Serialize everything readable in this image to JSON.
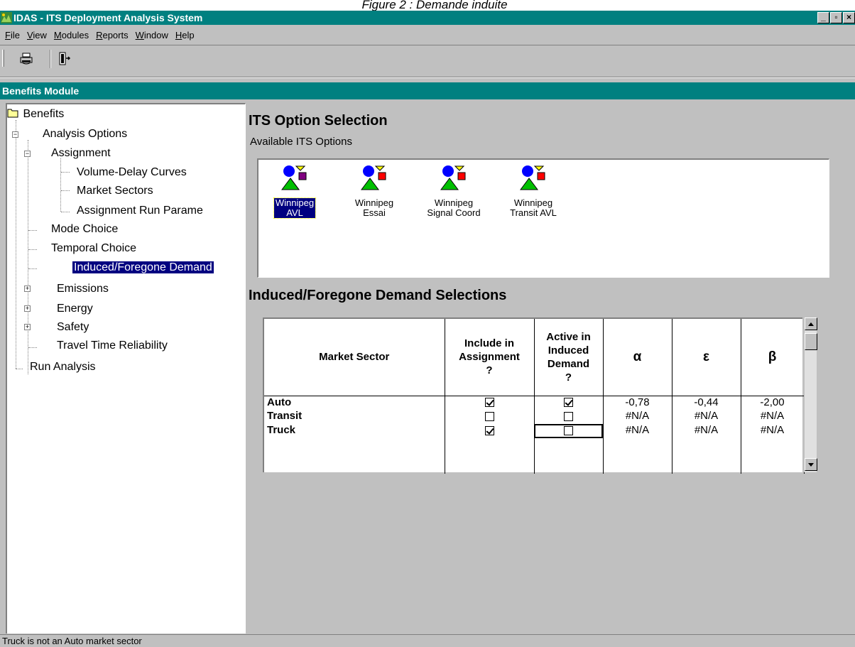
{
  "caption": "Figure 2 : Demande induite",
  "window": {
    "title": "IDAS - ITS Deployment Analysis System",
    "buttons": [
      "_",
      "▫",
      "×"
    ]
  },
  "menu": [
    "File",
    "View",
    "Modules",
    "Reports",
    "Window",
    "Help"
  ],
  "toolbar": {
    "buttons": [
      "printer-icon",
      "exit-icon"
    ]
  },
  "module": {
    "title": "Benefits Module"
  },
  "tree": {
    "root": "Benefits",
    "analysis_options": "Analysis Options",
    "assignment": "Assignment",
    "volume_delay": "Volume-Delay Curves",
    "market_sectors": "Market Sectors",
    "assignment_run": "Assignment Run Parame",
    "mode_choice": "Mode Choice",
    "temporal_choice": "Temporal Choice",
    "induced_demand": "Induced/Foregone Demand",
    "emissions": "Emissions",
    "energy": "Energy",
    "safety": "Safety",
    "travel_time": "Travel Time Reliability",
    "run_analysis": "Run Analysis"
  },
  "main": {
    "heading": "ITS Option Selection",
    "available_label": "Available ITS Options",
    "options": [
      {
        "line1": "Winnipeg",
        "line2": "AVL",
        "selected": true
      },
      {
        "line1": "Winnipeg",
        "line2": "Essai",
        "selected": false
      },
      {
        "line1": "Winnipeg",
        "line2": "Signal Coord",
        "selected": false
      },
      {
        "line1": "Winnipeg",
        "line2": "Transit AVL",
        "selected": false
      }
    ],
    "demand_heading": "Induced/Foregone Demand Selections",
    "table": {
      "headers": {
        "market_sector": "Market Sector",
        "include_1": "Include in",
        "include_2": "Assignment",
        "include_3": "?",
        "active_1": "Active in",
        "active_2": "Induced",
        "active_3": "Demand",
        "active_4": "?",
        "alpha": "α",
        "epsilon": "ε",
        "beta": "β"
      },
      "rows": [
        {
          "name": "Auto",
          "include": true,
          "active": true,
          "alpha": "-0,78",
          "epsilon": "-0,44",
          "beta": "-2,00"
        },
        {
          "name": "Transit",
          "include": false,
          "active": false,
          "alpha": "#N/A",
          "epsilon": "#N/A",
          "beta": "#N/A"
        },
        {
          "name": "Truck",
          "include": true,
          "active": false,
          "alpha": "#N/A",
          "epsilon": "#N/A",
          "beta": "#N/A"
        }
      ]
    }
  },
  "status": "Truck is not an Auto market sector"
}
